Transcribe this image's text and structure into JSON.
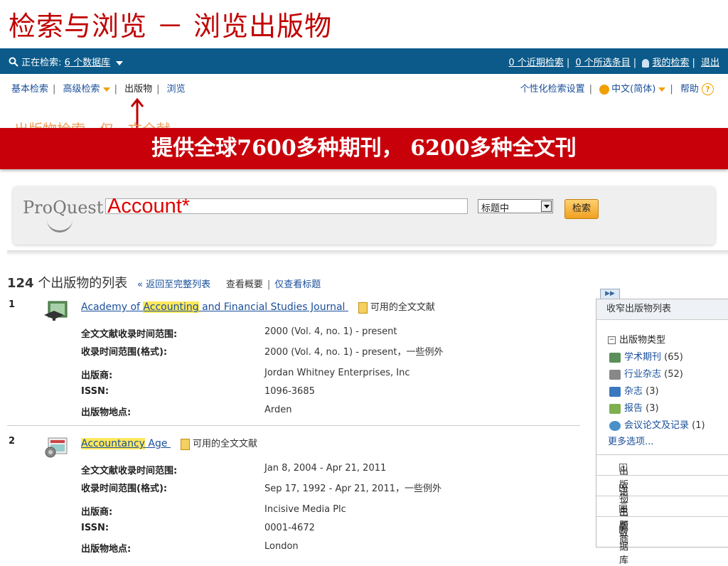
{
  "slide": {
    "title": "检索与浏览 － 浏览出版物"
  },
  "topbar": {
    "searching_prefix": "正在检索:",
    "db_link": "6 个数据库",
    "recent_searches": "0 个近期检索",
    "selected_items": "0 个所选条目",
    "my_research": "我的检索",
    "logout": "退出"
  },
  "nav": {
    "basic": "基本检索",
    "advanced": "高级检索",
    "publications": "出版物",
    "browse": "浏览",
    "preferences": "个性化检索设置",
    "language": "中文(简体)",
    "help": "帮助"
  },
  "faded_text": "出版物检索 - 仅 - 文全献",
  "banner": {
    "text": "提供全球7600多种期刊， 6200多种全文刊"
  },
  "search": {
    "logo": "ProQuest",
    "input_value": "",
    "account_overlay": "Account*",
    "select_value": "标题中",
    "button": "检索"
  },
  "list": {
    "count": "124",
    "count_suffix": "个出版物的列表",
    "back_link": "« 返回至完整列表",
    "summary": "查看概要",
    "titles_only": "仅查看标题"
  },
  "results": [
    {
      "num": "1",
      "title_pre": "Academy of ",
      "title_hl": "Accounting",
      "title_post": " and Financial Studies Journal",
      "fulltext": "可用的全文文献",
      "fields": [
        {
          "label": "全文文献收录时间范围:",
          "value": "2000 (Vol. 4, no. 1) - present"
        },
        {
          "label": "收录时间范围(格式):",
          "value": "2000 (Vol. 4, no. 1) - present，一些例外"
        },
        {
          "label": "出版商:",
          "value": "Jordan Whitney Enterprises, Inc"
        },
        {
          "label": "ISSN:",
          "value": "1096-3685"
        },
        {
          "label": "出版物地点:",
          "value": "Arden"
        }
      ]
    },
    {
      "num": "2",
      "title_pre": "",
      "title_hl": "Accountancy",
      "title_post": " Age",
      "fulltext": "可用的全文文献",
      "fields": [
        {
          "label": "全文文献收录时间范围:",
          "value": "Jan 8, 2004 - Apr 21, 2011"
        },
        {
          "label": "收录时间范围(格式):",
          "value": "Sep 17, 1992 - Apr 21, 2011，一些例外"
        },
        {
          "label": "出版商:",
          "value": "Incisive Media Plc"
        },
        {
          "label": "ISSN:",
          "value": "0001-4672"
        },
        {
          "label": "出版物地点:",
          "value": "London"
        }
      ]
    }
  ],
  "sidebar": {
    "tab": "▶▶",
    "header": "收窄出版物列表",
    "section": "出版物类型",
    "items": [
      {
        "label": "学术期刊",
        "count": "(65)",
        "icon": "journal-icon"
      },
      {
        "label": "行业杂志",
        "count": "(52)",
        "icon": "trade-icon"
      },
      {
        "label": "杂志",
        "count": "(3)",
        "icon": "magazine-icon"
      },
      {
        "label": "报告",
        "count": "(3)",
        "icon": "report-icon"
      },
      {
        "label": "会议论文及记录",
        "count": "(1)",
        "icon": "conference-icon"
      }
    ],
    "more": "更多选项...",
    "collapsed": [
      "出版物主题",
      "语言",
      "出版商",
      "数据库"
    ]
  },
  "colors": {
    "brand_blue": "#0b5a8a",
    "banner_red": "#c8000a",
    "link": "#1a4f9a",
    "highlight": "#ffe85c"
  }
}
